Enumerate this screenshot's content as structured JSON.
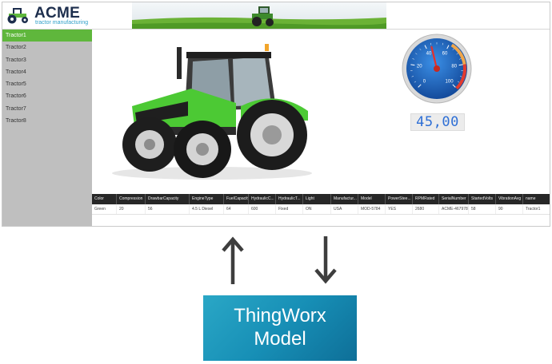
{
  "app": {
    "logo_title": "ACME",
    "logo_subtitle": "tractor manufacturing",
    "brand_color": "#5fb73c",
    "navy_color": "#1d2e4d"
  },
  "sidebar": {
    "items": [
      {
        "label": "Tractor1",
        "selected": true
      },
      {
        "label": "Tractor2"
      },
      {
        "label": "Tractor3"
      },
      {
        "label": "Tractor4"
      },
      {
        "label": "Tractor5"
      },
      {
        "label": "Tractor6"
      },
      {
        "label": "Tractor7"
      },
      {
        "label": "Tractor8"
      }
    ]
  },
  "gauge": {
    "ticks": [
      "0",
      "20",
      "40",
      "60",
      "80",
      "100"
    ],
    "value": 45,
    "min": 0,
    "max": 100,
    "readout": "45,00",
    "readout_color": "#2e6fd6"
  },
  "table": {
    "headers": [
      "Color",
      "Compression",
      "DrawbarCapacity",
      "EngineType",
      "FuelCapacity",
      "HydraulicC...",
      "HydraulicT...",
      "Light",
      "Manufactur...",
      "Model",
      "PowerStee...",
      "RPMRated",
      "SerialNumber",
      "StartedVolts",
      "VibrationAvg",
      "name"
    ],
    "rows": [
      [
        "Green",
        "20",
        "56",
        "4.5 L Diesel",
        "64",
        "600",
        "Fixed",
        "ON",
        "USA",
        "MOD-5784",
        "YES",
        "2680",
        "ACME-467978",
        "58",
        "90",
        "Tractor1"
      ]
    ]
  },
  "model_box": {
    "line1": "ThingWorx",
    "line2": "Model"
  }
}
